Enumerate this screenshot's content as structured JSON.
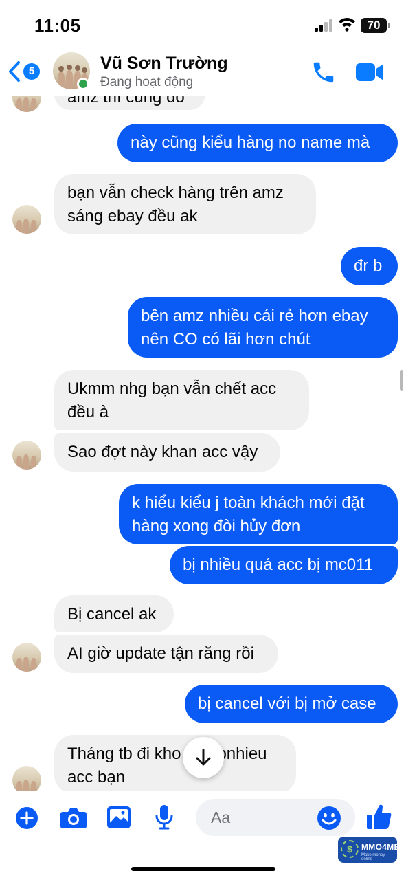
{
  "status_bar": {
    "time": "11:05",
    "battery": "70"
  },
  "header": {
    "back_count": "5",
    "contact_name": "Vũ Sơn Trường",
    "contact_status": "Đang hoạt động"
  },
  "messages": [
    {
      "from": "them",
      "lines": [
        "amz thì cũng đó"
      ]
    },
    {
      "from": "me",
      "lines": [
        "này cũng kiểu hàng no name mà"
      ]
    },
    {
      "from": "them",
      "lines": [
        "bạn vẫn check hàng trên amz",
        "sáng ebay đều ak"
      ]
    },
    {
      "from": "me",
      "lines": [
        "đr b"
      ]
    },
    {
      "from": "me",
      "lines": [
        "bên amz nhiều cái rẻ hơn ebay",
        "nên CO có lãi hơn chút"
      ]
    },
    {
      "from": "them",
      "lines": [
        "Ukmm nhg bạn vẫn chết acc",
        "đều à"
      ]
    },
    {
      "from": "them",
      "lines": [
        "Sao đợt này khan acc vậy"
      ]
    },
    {
      "from": "me",
      "lines": [
        "k hiểu kiểu j toàn khách mới đặt",
        "hàng xong đòi hủy đơn"
      ]
    },
    {
      "from": "me",
      "lines": [
        "bị nhiều quá acc bị mc011"
      ]
    },
    {
      "from": "them",
      "lines": [
        "Bị cancel ak"
      ]
    },
    {
      "from": "them",
      "lines": [
        "AI giờ update tận răng rồi"
      ]
    },
    {
      "from": "me",
      "lines": [
        "bị cancel với bị mở case"
      ]
    },
    {
      "from": "them",
      "lines": [
        "Tháng tb đi kho",
        "acc bạn"
      ],
      "trailing": "bnhieu"
    }
  ],
  "composer": {
    "placeholder": "Aa"
  },
  "watermark": {
    "logo": "$",
    "text": "MMO4ME",
    "sub": "Make money online"
  },
  "colors": {
    "accent": "#0a7cff",
    "outgoing_bubble": "#0a5bf5",
    "incoming_bubble": "#f0f0f0",
    "online": "#31a24c"
  }
}
